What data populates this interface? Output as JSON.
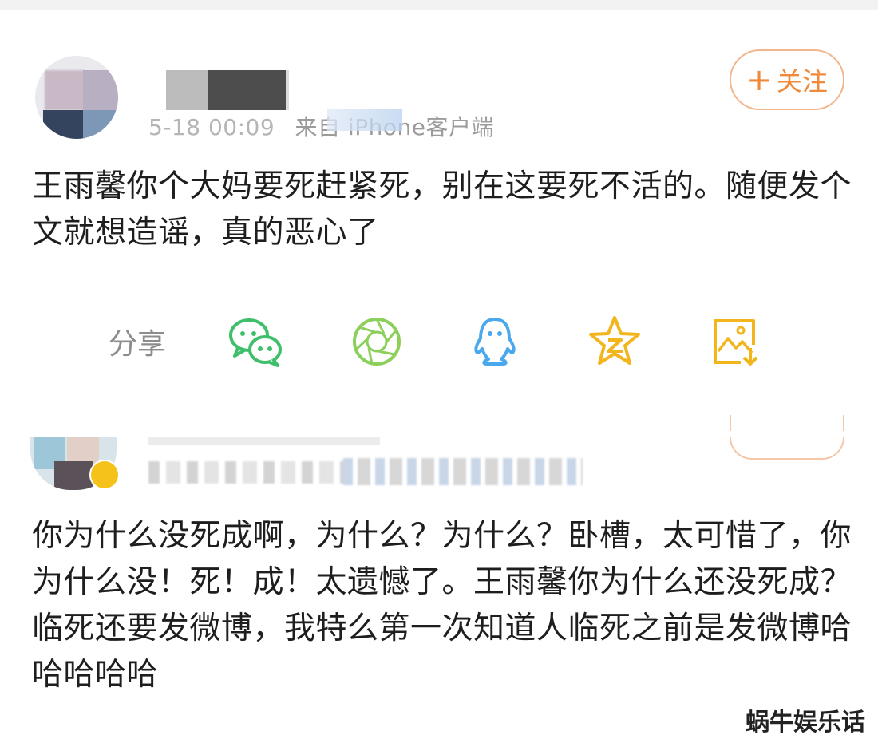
{
  "post1": {
    "meta_time": "5-18 00:09",
    "meta_source": "来自 iPhone客户端",
    "follow_label": "关注",
    "text": "王雨馨你个大妈要死赶紧死，别在这要死不活的。随便发个文就想造谣，真的恶心了"
  },
  "share": {
    "label": "分享",
    "targets": [
      {
        "name": "wechat-icon",
        "color": "#3fbf6a"
      },
      {
        "name": "moments-icon",
        "color": "#8ccf5a"
      },
      {
        "name": "qq-icon",
        "color": "#4aa8ec"
      },
      {
        "name": "qzone-icon",
        "color": "#f2b51c"
      },
      {
        "name": "save-image-icon",
        "color": "#f2b51c"
      }
    ]
  },
  "post2": {
    "text": "你为什么没死成啊，为什么？为什么？卧槽，太可惜了，你为什么没！死！成！太遗憾了。王雨馨你为什么还没死成？临死还要发微博，我特么第一次知道人临死之前是发微博哈哈哈哈哈"
  },
  "watermark": "蜗牛娱乐话"
}
